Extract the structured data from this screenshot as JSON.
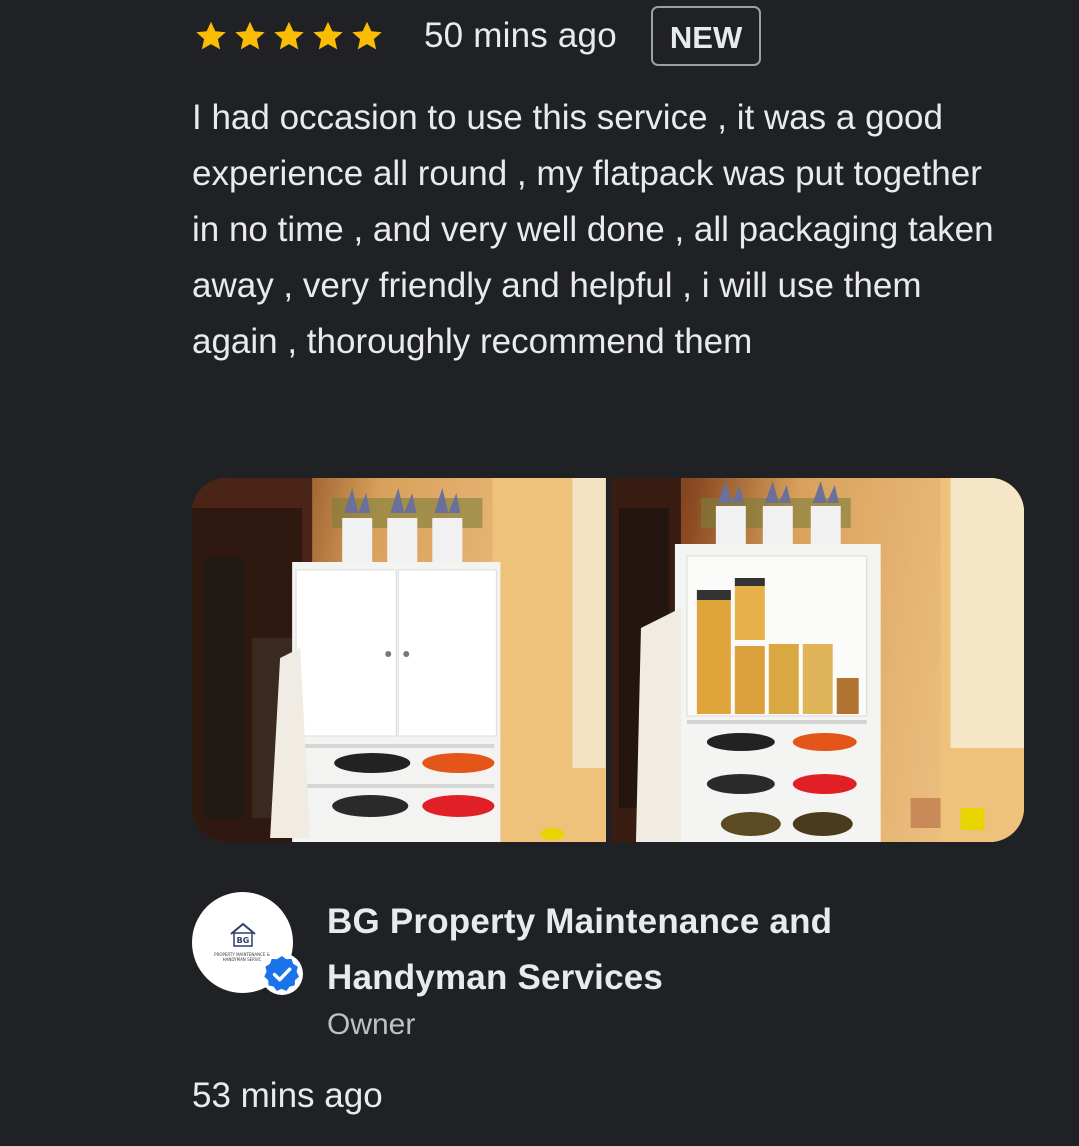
{
  "review": {
    "rating": 5,
    "rating_max": 5,
    "star_color": "#fbbc04",
    "time": "50 mins ago",
    "badge": "NEW",
    "text": "I had occasion to use this service , it was a good experience all round , my flatpack was put together in no time , and very well done , all packaging taken away , very friendly and helpful , i will use them again , thoroughly recommend them",
    "photos": [
      {
        "icon": "cabinet-closed-photo"
      },
      {
        "icon": "cabinet-open-photo"
      }
    ]
  },
  "owner_reply": {
    "name": "BG Property Maintenance and Handyman Services",
    "role": "Owner",
    "avatar_logo_text": "BG",
    "avatar_subtext": "PROPERTY MAINTENANCE & HANDYMAN SERVIC",
    "verified_icon": "verified-check-icon",
    "verified_color": "#1a73e8",
    "time": "53 mins ago"
  }
}
